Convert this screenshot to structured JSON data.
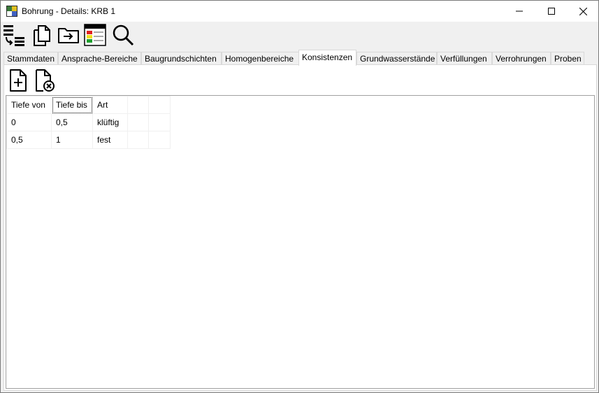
{
  "window": {
    "title": "Bohrung - Details: KRB 1",
    "minimize_icon": "minimize-icon",
    "maximize_icon": "maximize-icon",
    "close_icon": "close-icon"
  },
  "toolbar": {
    "buttons": [
      {
        "name": "list-sort-icon"
      },
      {
        "name": "copy-document-icon"
      },
      {
        "name": "folder-move-icon"
      },
      {
        "name": "legend-table-icon"
      },
      {
        "name": "search-icon"
      }
    ]
  },
  "tabs": [
    {
      "label": "Stammdaten",
      "active": false
    },
    {
      "label": "Ansprache-Bereiche",
      "active": false
    },
    {
      "label": "Baugrundschichten",
      "active": false
    },
    {
      "label": "Homogenbereiche",
      "active": false
    },
    {
      "label": "Konsistenzen",
      "active": true
    },
    {
      "label": "Grundwasserstände",
      "active": false
    },
    {
      "label": "Verfüllungen",
      "active": false
    },
    {
      "label": "Verrohrungen",
      "active": false
    },
    {
      "label": "Proben",
      "active": false
    }
  ],
  "subtoolbar": {
    "add_icon": "add-document-icon",
    "delete_icon": "delete-document-icon"
  },
  "grid": {
    "columns": [
      "Tiefe von",
      "Tiefe bis",
      "Art",
      "",
      ""
    ],
    "rows": [
      [
        "0",
        "0,5",
        "klüftig",
        "",
        ""
      ],
      [
        "0,5",
        "1",
        "fest",
        "",
        ""
      ]
    ]
  }
}
